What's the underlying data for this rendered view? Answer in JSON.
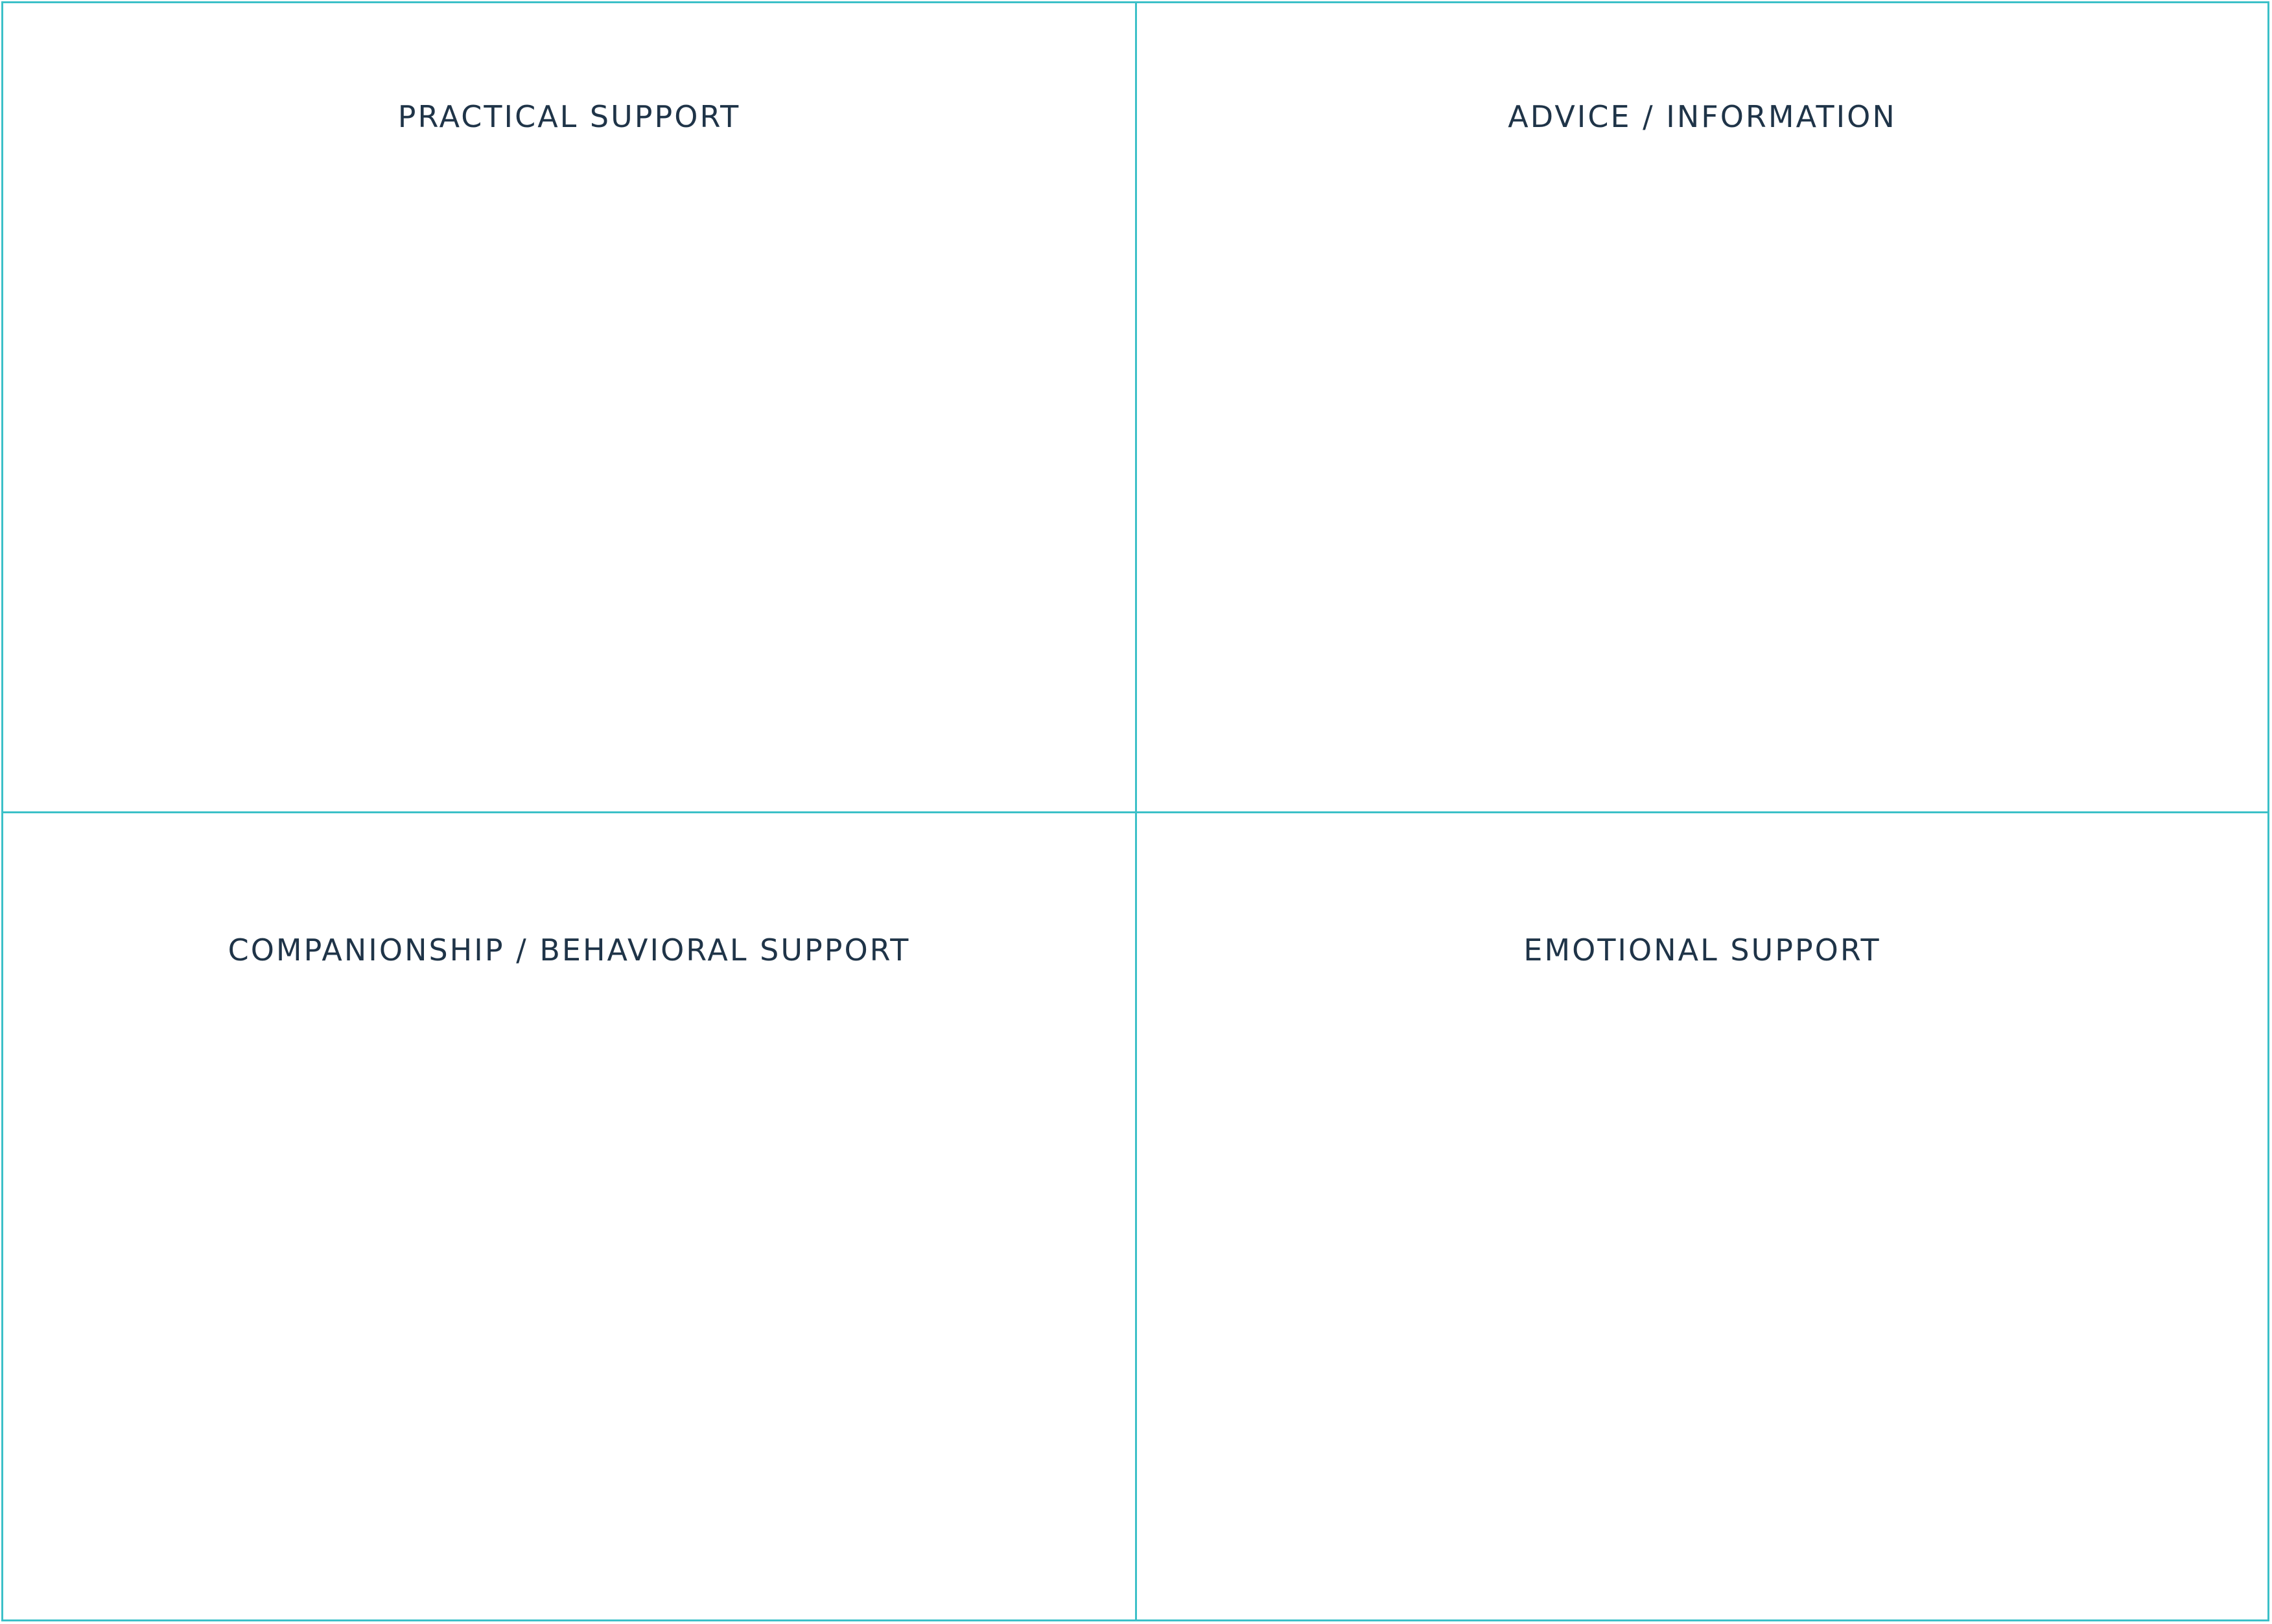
{
  "quadrants": {
    "top_left": {
      "label": "PRACTICAL SUPPORT"
    },
    "top_right": {
      "label": "ADVICE / INFORMATION"
    },
    "bottom_left": {
      "label": "COMPANIONSHIP / BEHAVIORAL SUPPORT"
    },
    "bottom_right": {
      "label": "EMOTIONAL SUPPORT"
    }
  },
  "colors": {
    "grid_line": "#3cc0c8",
    "text": "#1f3448",
    "background": "#ffffff"
  }
}
